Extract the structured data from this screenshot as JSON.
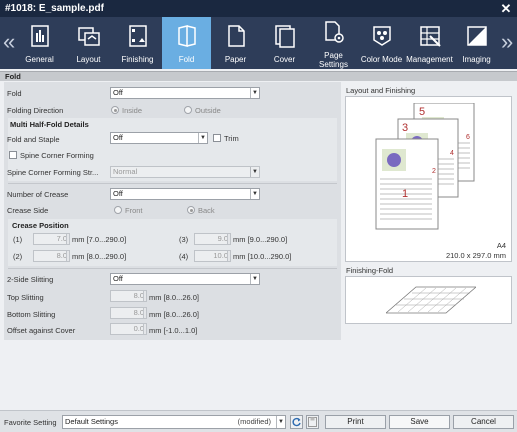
{
  "window": {
    "title": "#1018: E_sample.pdf",
    "close_glyph": "✕"
  },
  "tabs": {
    "prev_glyph": "«",
    "next_glyph": "»",
    "items": [
      {
        "label": "General",
        "icon": "general-icon"
      },
      {
        "label": "Layout",
        "icon": "layout-icon"
      },
      {
        "label": "Finishing",
        "icon": "finishing-icon"
      },
      {
        "label": "Fold",
        "icon": "fold-icon",
        "active": true
      },
      {
        "label": "Paper",
        "icon": "paper-icon"
      },
      {
        "label": "Cover",
        "icon": "cover-icon"
      },
      {
        "label": "Page\nSettings",
        "icon": "page-settings-icon"
      },
      {
        "label": "Color Mode",
        "icon": "color-mode-icon"
      },
      {
        "label": "Management",
        "icon": "management-icon"
      },
      {
        "label": "Imaging",
        "icon": "imaging-icon"
      }
    ]
  },
  "section_title": "Fold",
  "fold": {
    "fold_label": "Fold",
    "fold_value": "Off",
    "direction_label": "Folding Direction",
    "direction_inside": "Inside",
    "direction_outside": "Outside"
  },
  "multi_half_fold": {
    "title": "Multi Half-Fold Details",
    "fold_staple_label": "Fold and Staple",
    "fold_staple_value": "Off",
    "trim_label": "Trim",
    "spine_corner_check": "Spine Corner Forming",
    "spine_strength_label": "Spine Corner Forming Str...",
    "spine_strength_value": "Normal"
  },
  "crease": {
    "number_label": "Number of Crease",
    "number_value": "Off",
    "side_label": "Crease Side",
    "side_front": "Front",
    "side_back": "Back",
    "position_title": "Crease Position",
    "positions": [
      {
        "index": "(1)",
        "value": "7.0",
        "range": "mm [7.0...290.0]"
      },
      {
        "index": "(2)",
        "value": "8.0",
        "range": "mm [8.0...290.0]"
      },
      {
        "index": "(3)",
        "value": "9.0",
        "range": "mm [9.0...290.0]"
      },
      {
        "index": "(4)",
        "value": "10.0",
        "range": "mm [10.0...290.0]"
      }
    ]
  },
  "slitting": {
    "two_side_label": "2-Side Slitting",
    "two_side_value": "Off",
    "top_label": "Top Slitting",
    "top_value": "8.0",
    "top_range": "mm [8.0...26.0]",
    "bottom_label": "Bottom Slitting",
    "bottom_value": "8.0",
    "bottom_range": "mm [8.0...26.0]",
    "offset_label": "Offset against Cover",
    "offset_value": "0.0",
    "offset_range": "mm [-1.0...1.0]"
  },
  "preview": {
    "layout_title": "Layout and Finishing",
    "page_numbers": [
      "5",
      "3",
      "1"
    ],
    "side_numbers": [
      "6",
      "4",
      "2"
    ],
    "paper_size": "A4",
    "paper_dims": "210.0 x 297.0 mm",
    "fold_title": "Finishing-Fold"
  },
  "bottom": {
    "favorite_label": "Favorite Setting",
    "favorite_value": "Default Settings",
    "favorite_modified": "(modified)",
    "print_label": "Print",
    "save_label": "Save",
    "cancel_label": "Cancel"
  },
  "colors": {
    "titlebar": "#1a2840",
    "tabbar": "#2e3d59",
    "active_tab": "#6aaee2",
    "page_number": "#b03030"
  }
}
